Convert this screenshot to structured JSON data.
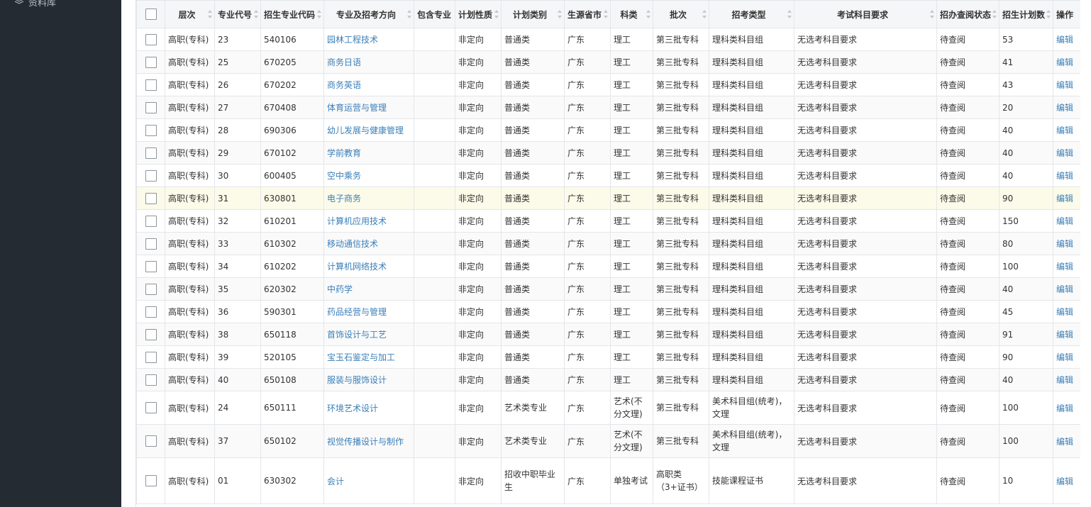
{
  "sidebar": {
    "item_label": "资料库"
  },
  "table": {
    "headers": [
      "层次",
      "专业代号",
      "招生专业代码",
      "专业及招考方向",
      "包含专业",
      "计划性质",
      "计划类别",
      "生源省市",
      "科类",
      "批次",
      "招考类型",
      "考试科目要求",
      "招办查阅状态",
      "招生计划数",
      "操作"
    ],
    "rows": [
      {
        "level": "高职(专科)",
        "code": "23",
        "major_code": "540106",
        "major": "园林工程技术",
        "include": "",
        "nature": "非定向",
        "category": "普通类",
        "province": "广东",
        "subject": "理工",
        "batch": "第三批专科",
        "exam_type": "理科类科目组",
        "requirement": "无选考科目要求",
        "status": "待查阅",
        "plan": "53",
        "action": "编辑"
      },
      {
        "level": "高职(专科)",
        "code": "25",
        "major_code": "670205",
        "major": "商务日语",
        "include": "",
        "nature": "非定向",
        "category": "普通类",
        "province": "广东",
        "subject": "理工",
        "batch": "第三批专科",
        "exam_type": "理科类科目组",
        "requirement": "无选考科目要求",
        "status": "待查阅",
        "plan": "41",
        "action": "编辑"
      },
      {
        "level": "高职(专科)",
        "code": "26",
        "major_code": "670202",
        "major": "商务英语",
        "include": "",
        "nature": "非定向",
        "category": "普通类",
        "province": "广东",
        "subject": "理工",
        "batch": "第三批专科",
        "exam_type": "理科类科目组",
        "requirement": "无选考科目要求",
        "status": "待查阅",
        "plan": "43",
        "action": "编辑"
      },
      {
        "level": "高职(专科)",
        "code": "27",
        "major_code": "670408",
        "major": "体育运营与管理",
        "include": "",
        "nature": "非定向",
        "category": "普通类",
        "province": "广东",
        "subject": "理工",
        "batch": "第三批专科",
        "exam_type": "理科类科目组",
        "requirement": "无选考科目要求",
        "status": "待查阅",
        "plan": "20",
        "action": "编辑"
      },
      {
        "level": "高职(专科)",
        "code": "28",
        "major_code": "690306",
        "major": "幼儿发展与健康管理",
        "include": "",
        "nature": "非定向",
        "category": "普通类",
        "province": "广东",
        "subject": "理工",
        "batch": "第三批专科",
        "exam_type": "理科类科目组",
        "requirement": "无选考科目要求",
        "status": "待查阅",
        "plan": "40",
        "action": "编辑"
      },
      {
        "level": "高职(专科)",
        "code": "29",
        "major_code": "670102",
        "major": "学前教育",
        "include": "",
        "nature": "非定向",
        "category": "普通类",
        "province": "广东",
        "subject": "理工",
        "batch": "第三批专科",
        "exam_type": "理科类科目组",
        "requirement": "无选考科目要求",
        "status": "待查阅",
        "plan": "40",
        "action": "编辑"
      },
      {
        "level": "高职(专科)",
        "code": "30",
        "major_code": "600405",
        "major": "空中乘务",
        "include": "",
        "nature": "非定向",
        "category": "普通类",
        "province": "广东",
        "subject": "理工",
        "batch": "第三批专科",
        "exam_type": "理科类科目组",
        "requirement": "无选考科目要求",
        "status": "待查阅",
        "plan": "40",
        "action": "编辑"
      },
      {
        "level": "高职(专科)",
        "code": "31",
        "major_code": "630801",
        "major": "电子商务",
        "include": "",
        "nature": "非定向",
        "category": "普通类",
        "province": "广东",
        "subject": "理工",
        "batch": "第三批专科",
        "exam_type": "理科类科目组",
        "requirement": "无选考科目要求",
        "status": "待查阅",
        "plan": "90",
        "action": "编辑"
      },
      {
        "level": "高职(专科)",
        "code": "32",
        "major_code": "610201",
        "major": "计算机应用技术",
        "include": "",
        "nature": "非定向",
        "category": "普通类",
        "province": "广东",
        "subject": "理工",
        "batch": "第三批专科",
        "exam_type": "理科类科目组",
        "requirement": "无选考科目要求",
        "status": "待查阅",
        "plan": "150",
        "action": "编辑"
      },
      {
        "level": "高职(专科)",
        "code": "33",
        "major_code": "610302",
        "major": "移动通信技术",
        "include": "",
        "nature": "非定向",
        "category": "普通类",
        "province": "广东",
        "subject": "理工",
        "batch": "第三批专科",
        "exam_type": "理科类科目组",
        "requirement": "无选考科目要求",
        "status": "待查阅",
        "plan": "80",
        "action": "编辑"
      },
      {
        "level": "高职(专科)",
        "code": "34",
        "major_code": "610202",
        "major": "计算机网络技术",
        "include": "",
        "nature": "非定向",
        "category": "普通类",
        "province": "广东",
        "subject": "理工",
        "batch": "第三批专科",
        "exam_type": "理科类科目组",
        "requirement": "无选考科目要求",
        "status": "待查阅",
        "plan": "100",
        "action": "编辑"
      },
      {
        "level": "高职(专科)",
        "code": "35",
        "major_code": "620302",
        "major": "中药学",
        "include": "",
        "nature": "非定向",
        "category": "普通类",
        "province": "广东",
        "subject": "理工",
        "batch": "第三批专科",
        "exam_type": "理科类科目组",
        "requirement": "无选考科目要求",
        "status": "待查阅",
        "plan": "40",
        "action": "编辑"
      },
      {
        "level": "高职(专科)",
        "code": "36",
        "major_code": "590301",
        "major": "药品经营与管理",
        "include": "",
        "nature": "非定向",
        "category": "普通类",
        "province": "广东",
        "subject": "理工",
        "batch": "第三批专科",
        "exam_type": "理科类科目组",
        "requirement": "无选考科目要求",
        "status": "待查阅",
        "plan": "45",
        "action": "编辑"
      },
      {
        "level": "高职(专科)",
        "code": "38",
        "major_code": "650118",
        "major": "首饰设计与工艺",
        "include": "",
        "nature": "非定向",
        "category": "普通类",
        "province": "广东",
        "subject": "理工",
        "batch": "第三批专科",
        "exam_type": "理科类科目组",
        "requirement": "无选考科目要求",
        "status": "待查阅",
        "plan": "91",
        "action": "编辑"
      },
      {
        "level": "高职(专科)",
        "code": "39",
        "major_code": "520105",
        "major": "宝玉石鉴定与加工",
        "include": "",
        "nature": "非定向",
        "category": "普通类",
        "province": "广东",
        "subject": "理工",
        "batch": "第三批专科",
        "exam_type": "理科类科目组",
        "requirement": "无选考科目要求",
        "status": "待查阅",
        "plan": "90",
        "action": "编辑"
      },
      {
        "level": "高职(专科)",
        "code": "40",
        "major_code": "650108",
        "major": "服装与服饰设计",
        "include": "",
        "nature": "非定向",
        "category": "普通类",
        "province": "广东",
        "subject": "理工",
        "batch": "第三批专科",
        "exam_type": "理科类科目组",
        "requirement": "无选考科目要求",
        "status": "待查阅",
        "plan": "40",
        "action": "编辑"
      },
      {
        "level": "高职(专科)",
        "code": "24",
        "major_code": "650111",
        "major": "环境艺术设计",
        "include": "",
        "nature": "非定向",
        "category": "艺术类专业",
        "province": "广东",
        "subject": "艺术(不分文理)",
        "batch": "第三批专科",
        "exam_type": "美术科目组(统考)，文理",
        "requirement": "无选考科目要求",
        "status": "待查阅",
        "plan": "100",
        "action": "编辑"
      },
      {
        "level": "高职(专科)",
        "code": "37",
        "major_code": "650102",
        "major": "视觉传播设计与制作",
        "include": "",
        "nature": "非定向",
        "category": "艺术类专业",
        "province": "广东",
        "subject": "艺术(不分文理)",
        "batch": "第三批专科",
        "exam_type": "美术科目组(统考)，文理",
        "requirement": "无选考科目要求",
        "status": "待查阅",
        "plan": "100",
        "action": "编辑"
      },
      {
        "level": "高职(专科)",
        "code": "01",
        "major_code": "630302",
        "major": "会计",
        "include": "",
        "nature": "非定向",
        "category": "招收中职毕业生",
        "province": "广东",
        "subject": "单独考试",
        "batch": "高职类（3+证书）",
        "exam_type": "技能课程证书",
        "requirement": "无选考科目要求",
        "status": "待查阅",
        "plan": "10",
        "action": "编辑"
      }
    ]
  }
}
